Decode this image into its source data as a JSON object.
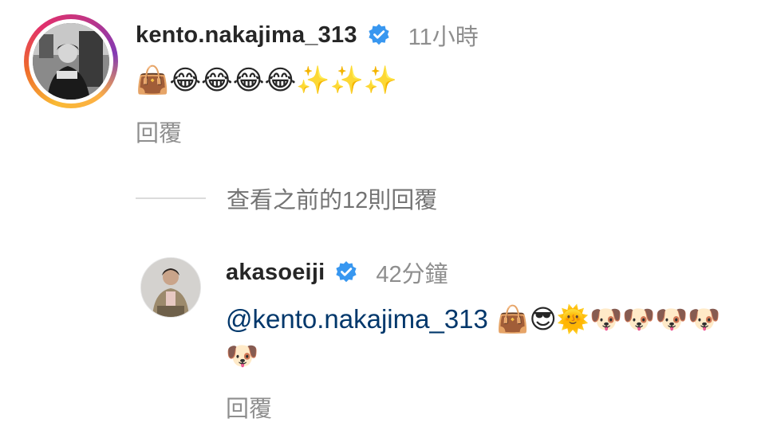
{
  "main_comment": {
    "username": "kento.nakajima_313",
    "time": "11小時",
    "text": "👜😂😂😂😂✨✨✨",
    "reply_label": "回覆"
  },
  "view_previous": {
    "label": "查看之前的12則回覆"
  },
  "reply_comment": {
    "username": "akasoeiji",
    "time": "42分鐘",
    "mention": "@kento.nakajima_313",
    "text": " 👜😎🌞🐶🐶🐶🐶🐶",
    "reply_label": "回覆"
  },
  "colors": {
    "verified_badge": "#3897f0",
    "mention": "#00376b",
    "secondary_text": "#8e8e8e"
  },
  "icons": {
    "verified": "verified-badge-icon"
  }
}
